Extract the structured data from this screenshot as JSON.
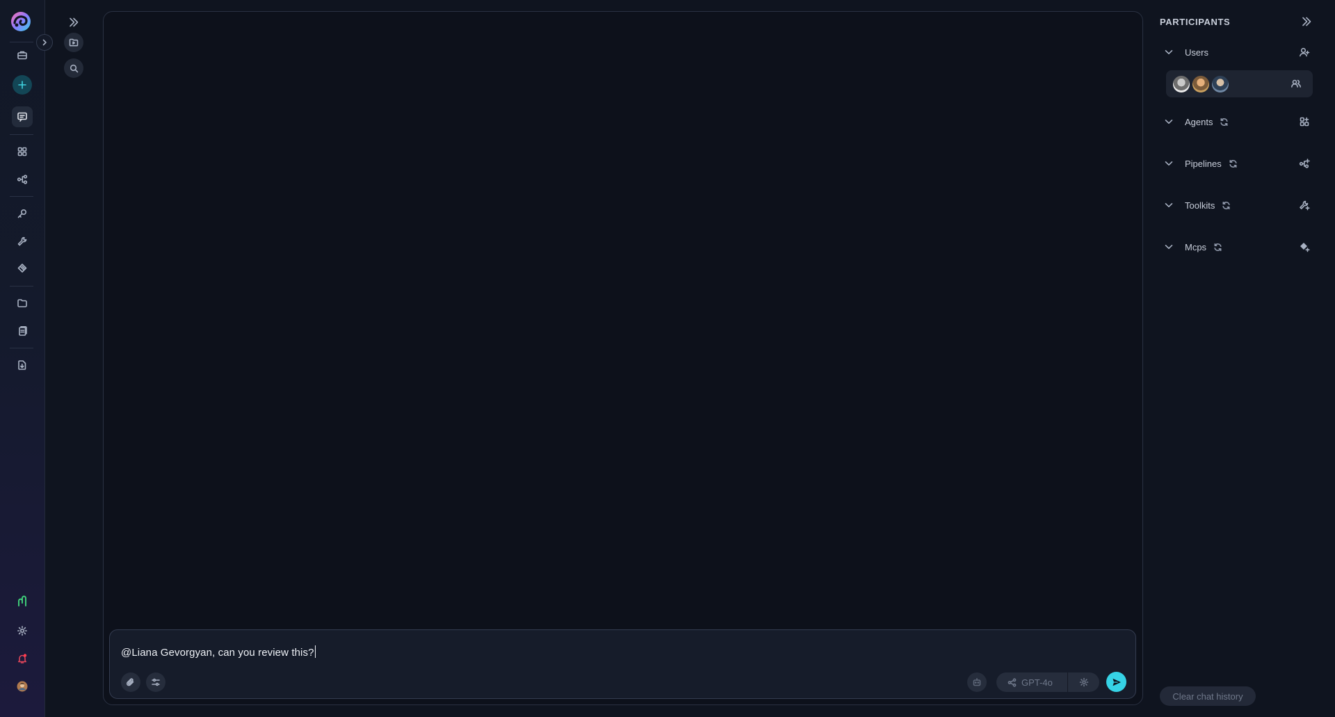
{
  "participants": {
    "title": "PARTICIPANTS",
    "sections": [
      {
        "label": "Users"
      },
      {
        "label": "Agents"
      },
      {
        "label": "Pipelines"
      },
      {
        "label": "Toolkits"
      },
      {
        "label": "Mcps"
      }
    ],
    "clear_history_label": "Clear chat history"
  },
  "composer": {
    "message": "@Liana Gevorgyan, can you review this?",
    "model": "GPT-4o"
  },
  "colors": {
    "accent": "#36d3e6",
    "background": "#0f141f",
    "panel": "#0d111b"
  },
  "icons": {
    "rail": [
      "app-logo",
      "briefcase-icon",
      "plus-icon",
      "chat-icon",
      "grid-icon",
      "pipeline-icon",
      "key-icon",
      "wrench-icon",
      "mcp-icon",
      "folder-icon",
      "documents-icon",
      "file-download-icon",
      "voice-icon",
      "settings-icon",
      "notification-bell-icon",
      "user-avatar"
    ]
  }
}
